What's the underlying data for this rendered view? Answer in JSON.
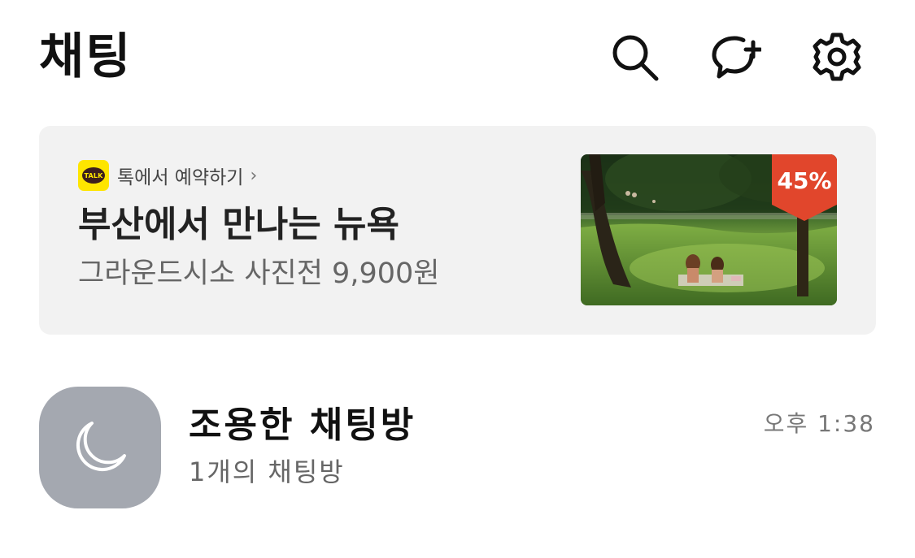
{
  "header": {
    "title": "채팅",
    "icons": [
      "search-icon",
      "new-chat-icon",
      "settings-icon"
    ]
  },
  "banner": {
    "source_logo_text": "TALK",
    "source_label": "톡에서 예약하기",
    "source_chevron": "›",
    "title": "부산에서 만나는 뉴욕",
    "subtitle": "그라운드시소 사진전 9,900원",
    "discount": "45%",
    "colors": {
      "background": "#f2f2f2",
      "logo": "#fee500",
      "badge": "#e1462c"
    }
  },
  "chat_list": [
    {
      "avatar_icon": "moon-icon",
      "name": "조용한 채팅방",
      "subtitle": "1개의 채팅방",
      "time": "오후 1:38",
      "avatar_color": "#a4a8b0"
    }
  ]
}
